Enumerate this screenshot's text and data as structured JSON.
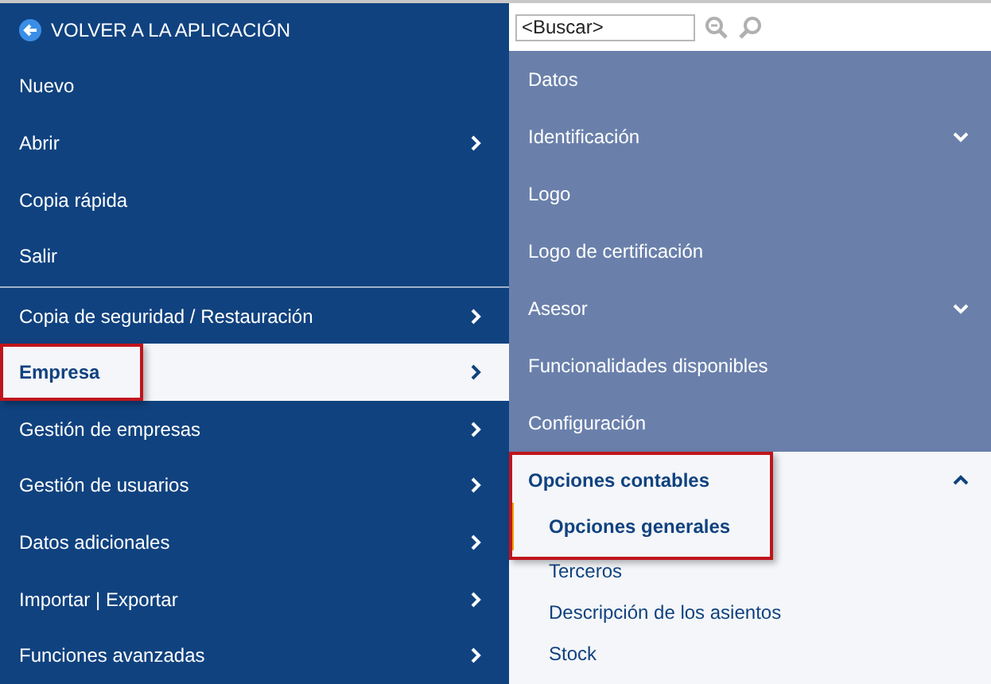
{
  "back_link": {
    "label": "VOLVER A LA APLICACIÓN"
  },
  "main_menu": {
    "sections": [
      [
        {
          "label": "Nuevo",
          "has_submenu": false,
          "selected": false,
          "highlighted": false
        },
        {
          "label": "Abrir",
          "has_submenu": true,
          "selected": false,
          "highlighted": false
        },
        {
          "label": "Copia rápida",
          "has_submenu": false,
          "selected": false,
          "highlighted": false
        },
        {
          "label": "Salir",
          "has_submenu": false,
          "selected": false,
          "highlighted": false
        }
      ],
      [
        {
          "label": "Copia de seguridad / Restauración",
          "has_submenu": true,
          "selected": false,
          "highlighted": false
        },
        {
          "label": "Empresa",
          "has_submenu": true,
          "selected": true,
          "highlighted": true
        },
        {
          "label": "Gestión de empresas",
          "has_submenu": true,
          "selected": false,
          "highlighted": false
        },
        {
          "label": "Gestión de usuarios",
          "has_submenu": true,
          "selected": false,
          "highlighted": false
        },
        {
          "label": "Datos adicionales",
          "has_submenu": true,
          "selected": false,
          "highlighted": false
        },
        {
          "label": "Importar | Exportar",
          "has_submenu": true,
          "selected": false,
          "highlighted": false
        },
        {
          "label": "Funciones avanzadas",
          "has_submenu": true,
          "selected": false,
          "highlighted": false
        }
      ]
    ]
  },
  "search": {
    "placeholder": "<Buscar>",
    "buttons_disabled": true
  },
  "submenu": {
    "items": [
      {
        "kind": "link",
        "label": "Datos"
      },
      {
        "kind": "group",
        "label": "Identificación",
        "expanded": false
      },
      {
        "kind": "link",
        "label": "Logo"
      },
      {
        "kind": "link",
        "label": "Logo de certificación"
      },
      {
        "kind": "group",
        "label": "Asesor",
        "expanded": false
      },
      {
        "kind": "link",
        "label": "Funcionalidades disponibles"
      },
      {
        "kind": "link",
        "label": "Configuración"
      },
      {
        "kind": "group",
        "label": "Opciones contables",
        "expanded": true,
        "highlighted": true,
        "children": [
          {
            "label": "Opciones generales",
            "selected": true
          },
          {
            "label": "Terceros",
            "selected": false
          },
          {
            "label": "Descripción de los asientos",
            "selected": false
          },
          {
            "label": "Stock",
            "selected": false
          }
        ]
      }
    ]
  }
}
